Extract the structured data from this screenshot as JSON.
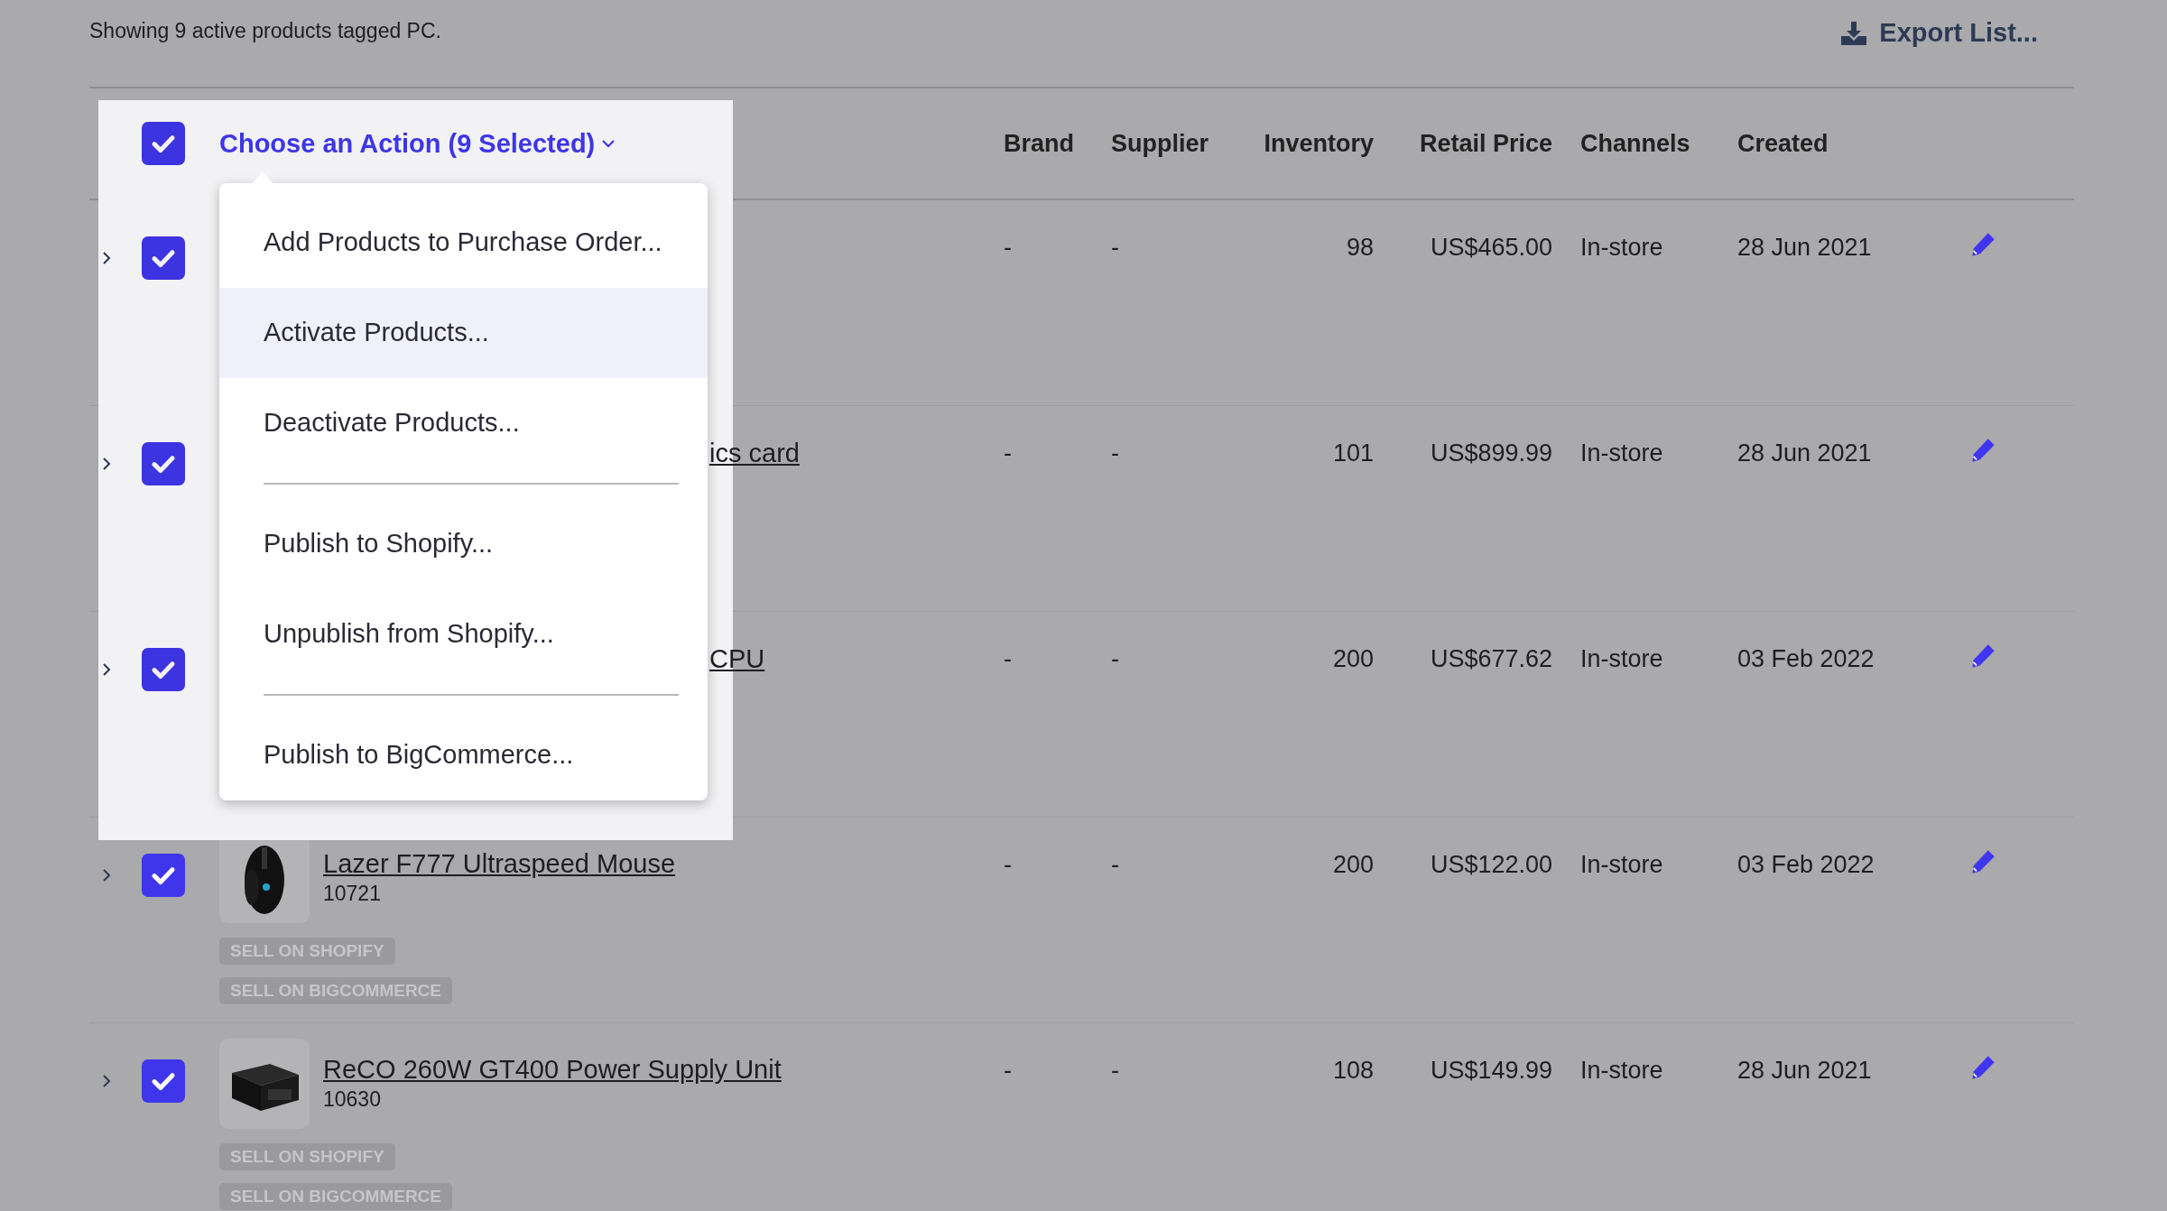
{
  "summary": "Showing 9 active products tagged PC.",
  "export_button": "Export List...",
  "table": {
    "select_all": {
      "checked": true
    },
    "action_menu": {
      "label": "Choose an Action (9 Selected)",
      "expanded": true,
      "items": [
        {
          "kind": "item",
          "label": "Add Products to Purchase Order...",
          "highlighted": false
        },
        {
          "kind": "item",
          "label": "Activate Products...",
          "highlighted": true
        },
        {
          "kind": "item",
          "label": "Deactivate Products...",
          "highlighted": false
        },
        {
          "kind": "divider"
        },
        {
          "kind": "item",
          "label": "Publish to Shopify...",
          "highlighted": false
        },
        {
          "kind": "item",
          "label": "Unpublish from Shopify...",
          "highlighted": false
        },
        {
          "kind": "divider"
        },
        {
          "kind": "item",
          "label": "Publish to BigCommerce...",
          "highlighted": false
        }
      ]
    },
    "columns": [
      "Brand",
      "Supplier",
      "Inventory",
      "Retail Price",
      "Channels",
      "Created"
    ],
    "rows": [
      {
        "expanded": false,
        "checked": true,
        "product": {
          "kind": "covered"
        },
        "brand": "-",
        "supplier": "-",
        "inventory": "98",
        "price": "US$465.00",
        "channels": "In-store",
        "created": "28 Jun 2021"
      },
      {
        "expanded": false,
        "checked": true,
        "product": {
          "kind": "covered",
          "name": "ics card"
        },
        "brand": "-",
        "supplier": "-",
        "inventory": "101",
        "price": "US$899.99",
        "channels": "In-store",
        "created": "28 Jun 2021"
      },
      {
        "expanded": false,
        "checked": true,
        "product": {
          "kind": "covered",
          "name": "CPU"
        },
        "brand": "-",
        "supplier": "-",
        "inventory": "200",
        "price": "US$677.62",
        "channels": "In-store",
        "created": "03 Feb 2022"
      },
      {
        "expanded": false,
        "checked": true,
        "product": {
          "kind": "full",
          "name": "Lazer F777 Ultraspeed Mouse",
          "sku": "10721",
          "tags": [
            "SELL ON SHOPIFY",
            "SELL ON BIGCOMMERCE"
          ]
        },
        "brand": "-",
        "supplier": "-",
        "inventory": "200",
        "price": "US$122.00",
        "channels": "In-store",
        "created": "03 Feb 2022"
      },
      {
        "expanded": false,
        "checked": true,
        "product": {
          "kind": "full",
          "name": "ReCO 260W GT400 Power Supply Unit",
          "sku": "10630",
          "tags": [
            "SELL ON SHOPIFY",
            "SELL ON BIGCOMMERCE"
          ]
        },
        "brand": "-",
        "supplier": "-",
        "inventory": "108",
        "price": "US$149.99",
        "channels": "In-store",
        "created": "28 Jun 2021"
      }
    ]
  }
}
